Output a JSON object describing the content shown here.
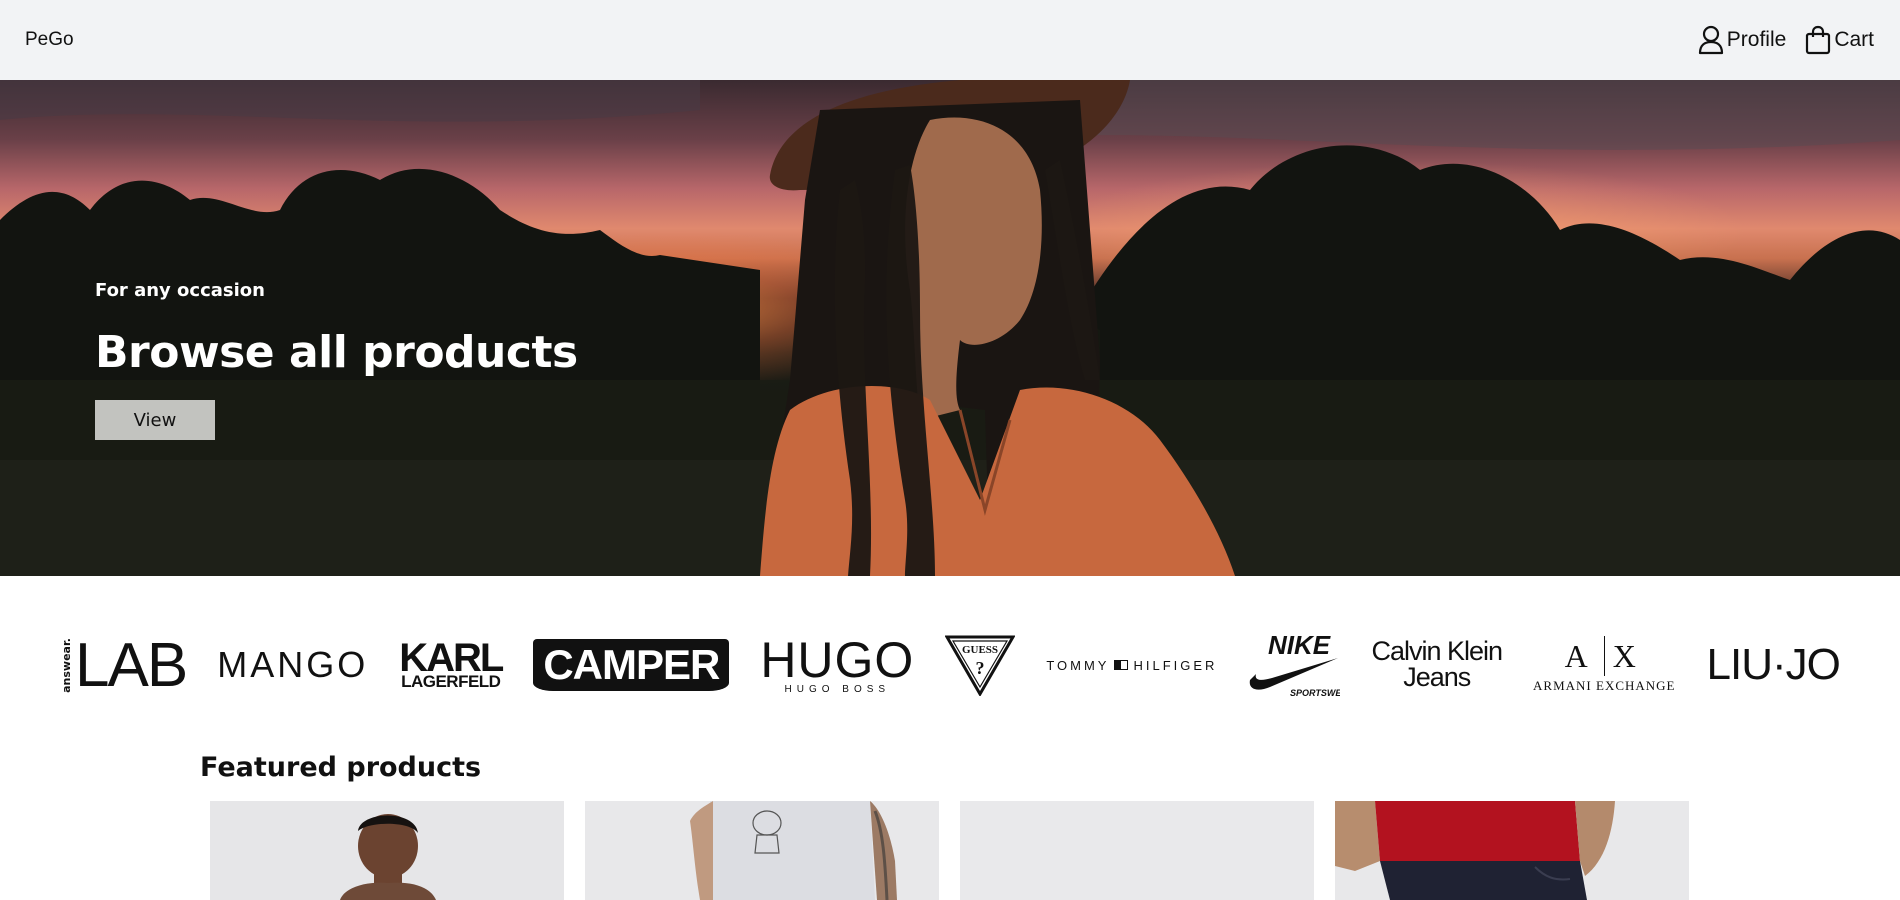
{
  "header": {
    "logo": "PeGo",
    "nav": {
      "profile_label": "Profile",
      "cart_label": "Cart"
    }
  },
  "hero": {
    "eyebrow": "For any occasion",
    "title": "Browse all products",
    "button_label": "View"
  },
  "brands": [
    {
      "prefix": "answear.",
      "name": "LAB"
    },
    {
      "name": "MANGO"
    },
    {
      "name_line1": "KARL",
      "name_line2": "LAGERFELD"
    },
    {
      "name": "CAMPER"
    },
    {
      "name": "HUGO",
      "sub": "HUGO BOSS"
    },
    {
      "name": "GUESS",
      "mark": "?"
    },
    {
      "name_left": "TOMMY",
      "name_right": "HILFIGER"
    },
    {
      "name": "NIKE",
      "sub": "SPORTSWEAR"
    },
    {
      "name_line1": "Calvin Klein",
      "name_line2": "Jeans"
    },
    {
      "left": "A",
      "right": "X",
      "sub": "ARMANI EXCHANGE"
    },
    {
      "left": "LIU",
      "right": "JO"
    }
  ],
  "featured": {
    "title": "Featured products"
  },
  "icons": {
    "profile": "user-icon",
    "cart": "shopping-bag-icon",
    "nike": "nike-swoosh-icon",
    "guess": "guess-triangle-icon"
  }
}
